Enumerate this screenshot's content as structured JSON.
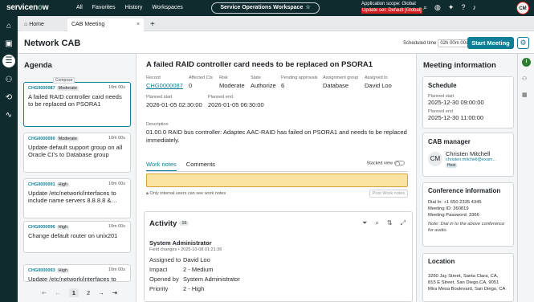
{
  "topnav": {
    "logo": "servicenow",
    "menu": [
      "All",
      "Favorites",
      "History",
      "Workspaces"
    ],
    "workspace_label": "Service Operations Workspace",
    "scope_line1": "Application scope: Global",
    "scope_line2": "Update set: Default [Global]",
    "avatar_initials": "CM"
  },
  "tabs": {
    "home": "Home",
    "current": "CAB Meeting"
  },
  "header": {
    "title": "Network CAB",
    "scheduled_label": "Scheduled time",
    "scheduled_value": "02h 00m 00s",
    "start_button": "Start Meeting"
  },
  "agenda": {
    "title": "Agenda",
    "compose_tooltip": "Compose",
    "items": [
      {
        "number": "CHG0000087",
        "priority": "Moderate",
        "duration": "10m 00s",
        "desc": "A failed RAID controller card needs to be replaced on PSORA1"
      },
      {
        "number": "CHG0000090",
        "priority": "Moderate",
        "duration": "10m 00s",
        "desc": "Update default support group on all Oracle CI's to Database group"
      },
      {
        "number": "CHG0000091",
        "priority": "High",
        "duration": "10m 00s",
        "desc": "Update /etc/network/interfaces to include name servers 8.8.8.8 &…"
      },
      {
        "number": "CHG0000096",
        "priority": "High",
        "duration": "10m 00s",
        "desc": "Change default router on unix201"
      },
      {
        "number": "CHG0000093",
        "priority": "High",
        "duration": "10m 00s",
        "desc": "Update /etc/network/interfaces to"
      }
    ],
    "pager": {
      "first": "⇤",
      "prev": "←",
      "page1": "1",
      "page2": "2",
      "next": "→",
      "last": "⇥"
    }
  },
  "detail": {
    "title": "A failed RAID controller card needs to be replaced on PSORA1",
    "record_label": "Record",
    "record_value": "CHG0000087",
    "affected_label": "Affected CIs",
    "affected_value": "0",
    "risk_label": "Risk",
    "risk_value": "Moderate",
    "state_label": "State",
    "state_value": "Authorize",
    "pending_label": "Pending approvals",
    "pending_value": "6",
    "group_label": "Assignment group",
    "group_value": "Database",
    "assigned_label": "Assigned to",
    "assigned_value": "David Loo",
    "pstart_label": "Planned start",
    "pstart_value": "2026-01-05 02:30:00",
    "pend_label": "Planned end",
    "pend_value": "2026-01-05 06:30:00",
    "desc_label": "Description",
    "desc_value": "01.00.0 RAID bus controller: Adaptec AAC-RAID has failed on PSORA1 and needs to be replaced immediately."
  },
  "worknotes": {
    "tab_worknotes": "Work notes",
    "tab_comments": "Comments",
    "stacked_label": "Stacked view",
    "note": "Only internal users can see work notes",
    "post_button": "Post Work notes"
  },
  "activity": {
    "title": "Activity",
    "count": "16",
    "author": "System Administrator",
    "meta": "Field changes • 2025-10-08 01:21:36",
    "changes": [
      {
        "k": "Assigned to",
        "v": "David Loo"
      },
      {
        "k": "Impact",
        "v": "2 - Medium"
      },
      {
        "k": "Opened by",
        "v": "System Administrator"
      },
      {
        "k": "Priority",
        "v": "2 - High"
      }
    ]
  },
  "meeting": {
    "title": "Meeting information",
    "schedule_title": "Schedule",
    "pstart_label": "Planned start",
    "pstart_value": "2025-12-30 09:00:00",
    "pend_label": "Planned end",
    "pend_value": "2025-12-30 11:00:00",
    "manager_title": "CAB manager",
    "manager_initials": "CM",
    "manager_name": "Christen Mitchell",
    "manager_email": "christen.mitchell@exam...",
    "manager_role": "Host",
    "conf_title": "Conference information",
    "dial_in": "Dial In: +1 650 2335 4345",
    "meeting_id": "Meeting ID: 360819",
    "meeting_pw": "Meeting Password: 3366",
    "conf_note": "Note: Dial in to the above conference for audio.",
    "location_title": "Location",
    "location_lines": [
      "3260 Jay Street, Santa Clara, CA,",
      "815 E Street, San Diego,CA, 9051",
      "Mira Mesa Boulevard, San Diego, CA"
    ]
  }
}
